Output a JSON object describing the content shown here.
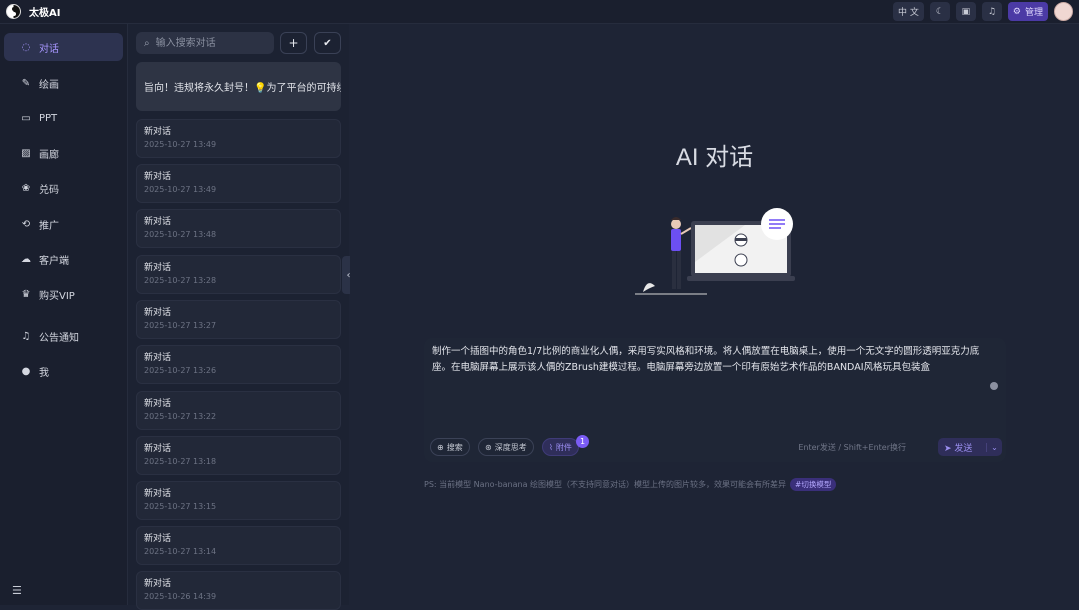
{
  "app": {
    "name": "太极AI"
  },
  "topbar": {
    "translate_label": "中 文",
    "admin_label": "管理"
  },
  "nav": {
    "items": [
      {
        "label": "对话",
        "icon": "chat-icon"
      },
      {
        "label": "绘画",
        "icon": "brush-icon"
      },
      {
        "label": "PPT",
        "icon": "ppt-icon"
      },
      {
        "label": "画廊",
        "icon": "gallery-icon"
      },
      {
        "label": "兑码",
        "icon": "gift-icon"
      },
      {
        "label": "推广",
        "icon": "share-icon"
      },
      {
        "label": "客户端",
        "icon": "cloud-icon"
      },
      {
        "label": "购买VIP",
        "icon": "crown-icon"
      },
      {
        "label": "公告通知",
        "icon": "bell-icon"
      },
      {
        "label": "我",
        "icon": "user-icon"
      }
    ]
  },
  "conversations": {
    "search_placeholder": "输入搜索对话",
    "notice": "旨向！违规将永久封号！💡为了平台的可持续",
    "items": [
      {
        "title": "新对话",
        "date": "2025-10-27 13:49"
      },
      {
        "title": "新对话",
        "date": "2025-10-27 13:49"
      },
      {
        "title": "新对话",
        "date": "2025-10-27 13:48"
      },
      {
        "title": "新对话",
        "date": "2025-10-27 13:28"
      },
      {
        "title": "新对话",
        "date": "2025-10-27 13:27"
      },
      {
        "title": "新对话",
        "date": "2025-10-27 13:26"
      },
      {
        "title": "新对话",
        "date": "2025-10-27 13:22"
      },
      {
        "title": "新对话",
        "date": "2025-10-27 13:18"
      },
      {
        "title": "新对话",
        "date": "2025-10-27 13:15"
      },
      {
        "title": "新对话",
        "date": "2025-10-27 13:14"
      },
      {
        "title": "新对话",
        "date": "2025-10-26 14:39"
      }
    ]
  },
  "main": {
    "title": "AI 对话",
    "prompt": "制作一个插图中的角色1/7比例的商业化人偶，采用写实风格和环境。将人偶放置在电脑桌上，使用一个无文字的圆形透明亚克力底座。在电脑屏幕上展示该人偶的ZBrush建模过程。电脑屏幕旁边放置一个印有原始艺术作品的BANDAI风格玩具包装盒",
    "chips": {
      "search": "搜索",
      "deep": "深度思考",
      "attach": "附件"
    },
    "attach_count": "1",
    "hint": "Enter发送 / Shift+Enter换行",
    "send_label": "发送",
    "footnote": "PS: 当前模型 Nano-banana 绘图模型（不支持同意对话）模型上传的图片较多，效果可能会有所差异",
    "footnote_link": "#切换模型"
  },
  "colors": {
    "accent": "#7b5cf5",
    "bg": "#1e2435",
    "panel": "#1a1f2e"
  }
}
